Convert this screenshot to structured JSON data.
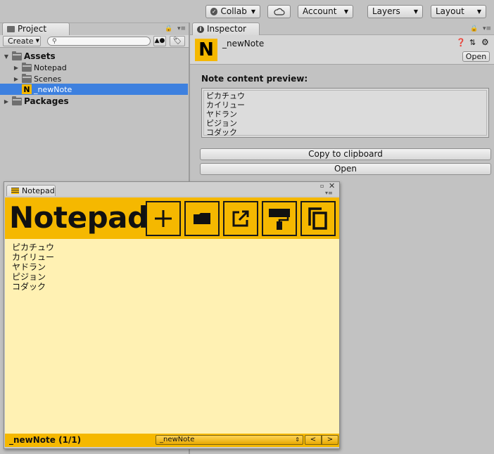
{
  "toolbar": {
    "collab_label": "Collab",
    "account_label": "Account",
    "layers_label": "Layers",
    "layout_label": "Layout"
  },
  "project": {
    "tab_label": "Project",
    "create_label": "Create",
    "search_placeholder": "",
    "tree": {
      "assets": "Assets",
      "notepad": "Notepad",
      "scenes": "Scenes",
      "newnote": "_newNote",
      "packages": "Packages"
    }
  },
  "inspector": {
    "tab_label": "Inspector",
    "asset_name": "_newNote",
    "open_small_label": "Open",
    "preview_heading": "Note content preview:",
    "preview_lines": [
      "ピカチュウ",
      "カイリュー",
      "ヤドラン",
      "ピジョン",
      "コダック"
    ],
    "copy_label": "Copy to clipboard",
    "open_label": "Open"
  },
  "notepad_window": {
    "tab_label": "Notepad",
    "title": "Notepad",
    "content_lines": [
      "ピカチュウ",
      "カイリュー",
      "ヤドラン",
      "ピジョン",
      "コダック"
    ],
    "status_label": "_newNote (1/1)",
    "note_select_value": "_newNote",
    "prev_label": "<",
    "next_label": ">"
  },
  "colors": {
    "accent": "#f5b800",
    "selection": "#3d80df",
    "note_bg": "#fff1b3",
    "editor_bg": "#c2c2c2"
  }
}
